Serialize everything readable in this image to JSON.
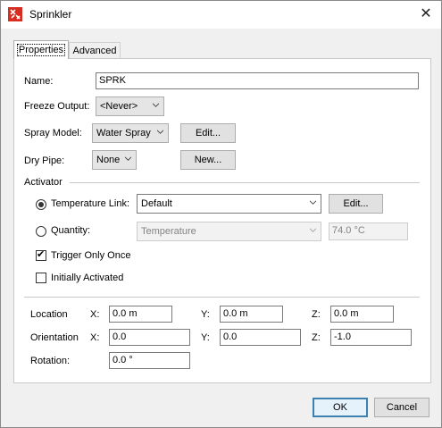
{
  "window": {
    "title": "Sprinkler",
    "close_glyph": "✕"
  },
  "tabs": [
    {
      "label": "Properties",
      "active": true
    },
    {
      "label": "Advanced",
      "active": false
    }
  ],
  "form": {
    "name_label": "Name:",
    "name_value": "SPRK",
    "freeze_label": "Freeze Output:",
    "freeze_value": "<Never>",
    "spray_label": "Spray Model:",
    "spray_value": "Water Spray",
    "spray_edit": "Edit...",
    "dry_pipe_label": "Dry Pipe:",
    "dry_pipe_value": "None",
    "dry_pipe_new": "New..."
  },
  "activator": {
    "title": "Activator",
    "temp_link_label": "Temperature Link:",
    "temp_link_selected": true,
    "temp_link_value": "Default",
    "temp_link_edit": "Edit...",
    "quantity_label": "Quantity:",
    "quantity_selected": false,
    "quantity_value": "Temperature",
    "quantity_amount": "74.0 °C",
    "trigger_once_label": "Trigger Only Once",
    "trigger_once_checked": true,
    "initially_activated_label": "Initially Activated",
    "initially_activated_checked": false
  },
  "location": {
    "location_label": "Location",
    "orientation_label": "Orientation",
    "rotation_label": "Rotation:",
    "x_label": "X:",
    "y_label": "Y:",
    "z_label": "Z:",
    "location_x": "0.0 m",
    "location_y": "0.0 m",
    "location_z": "0.0 m",
    "orientation_x": "0.0",
    "orientation_y": "0.0",
    "orientation_z": "-1.0",
    "rotation_value": "0.0 °"
  },
  "buttons": {
    "ok": "OK",
    "cancel": "Cancel"
  },
  "colors": {
    "accent": "#3c7fb1",
    "app_icon": "#d62d20",
    "window_bg": "#f0f0f0"
  },
  "icons": {
    "app": "sprinkler-app-icon",
    "close": "close-icon",
    "dropdown": "chevron-down-icon"
  }
}
